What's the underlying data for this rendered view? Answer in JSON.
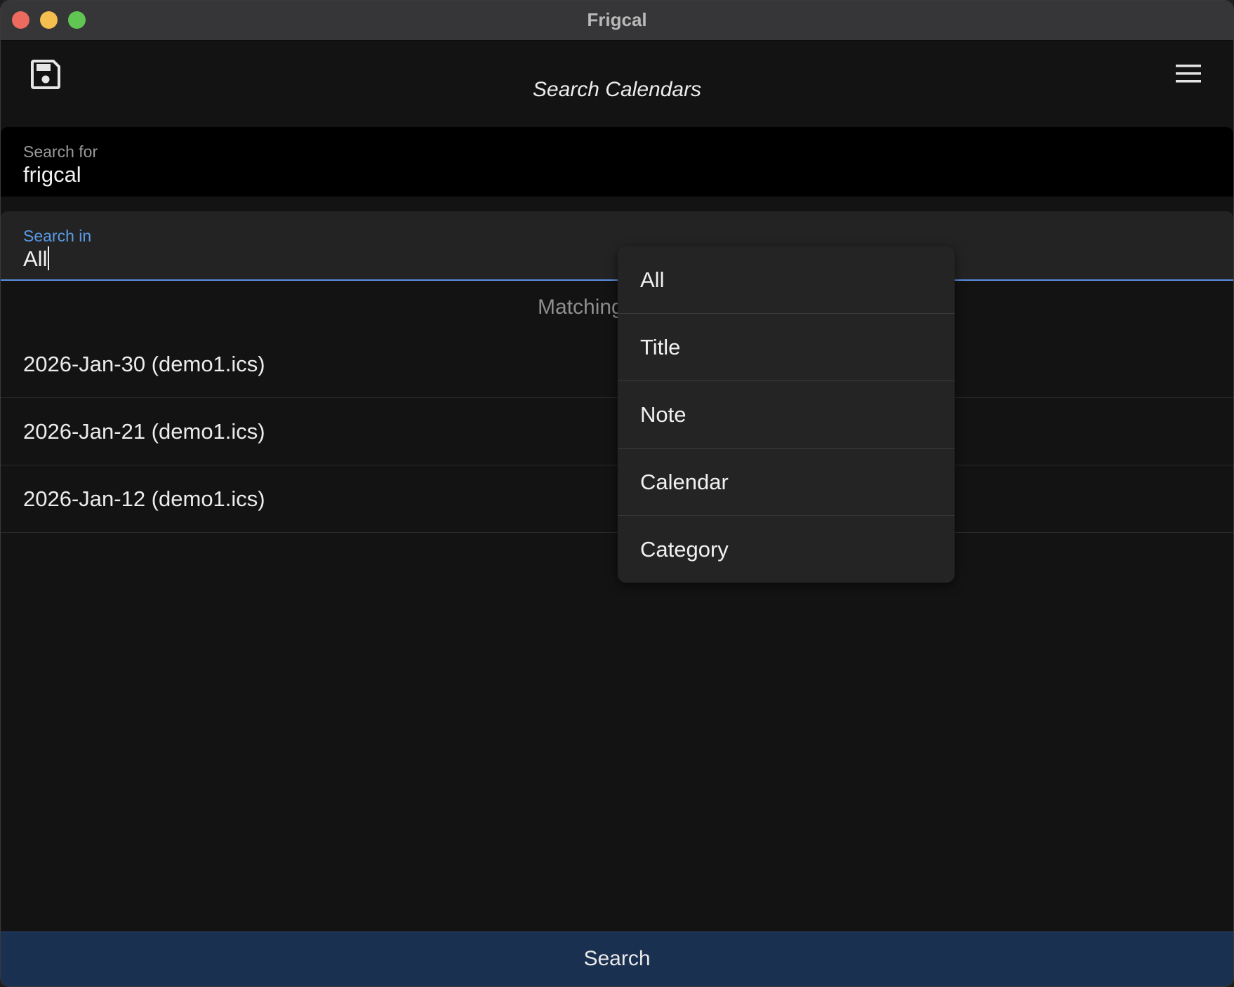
{
  "window": {
    "title": "Frigcal"
  },
  "appbar": {
    "title": "Search Calendars",
    "save_icon": "save-icon",
    "menu_icon": "hamburger-menu-icon"
  },
  "search_for": {
    "label": "Search for",
    "value": "frigcal"
  },
  "search_in": {
    "label": "Search in",
    "value": "All"
  },
  "results": {
    "header": "Matching",
    "items": [
      "2026-Jan-30 (demo1.ics)",
      "2026-Jan-21 (demo1.ics)",
      "2026-Jan-12 (demo1.ics)"
    ]
  },
  "dropdown": {
    "options": [
      "All",
      "Title",
      "Note",
      "Calendar",
      "Category"
    ]
  },
  "search_button": {
    "label": "Search"
  },
  "colors": {
    "accent": "#5a9be8",
    "button_bg": "#1a3050",
    "background": "#131313"
  }
}
